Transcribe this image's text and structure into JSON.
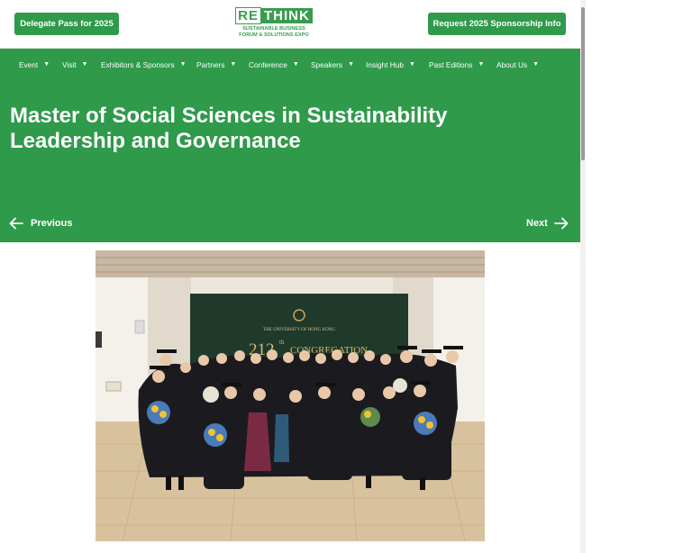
{
  "header": {
    "left_button": "Delegate Pass for 2025",
    "right_button": "Request 2025 Sponsorship Info",
    "logo_word_1": "RE",
    "logo_word_2": "THINK",
    "logo_line_1": "SUSTAINABLE BUSINESS",
    "logo_line_2": "FORUM & SOLUTIONS EXPO"
  },
  "nav": {
    "items": [
      {
        "label": "Event"
      },
      {
        "label": "Visit"
      },
      {
        "label": "Exhibitors & Sponsors"
      },
      {
        "label": "Partners"
      },
      {
        "label": "Conference"
      },
      {
        "label": "Speakers"
      },
      {
        "label": "Insight Hub"
      },
      {
        "label": "Past Editions"
      },
      {
        "label": "About Us"
      }
    ],
    "caret": "▼"
  },
  "hero": {
    "title": "Master of Social Sciences in Sustainability Leadership and Governance",
    "prev_label": "Previous",
    "next_label": "Next"
  },
  "photo": {
    "banner_line": "THE UNIVERSITY OF HONG KONG",
    "banner_number": "212",
    "banner_suffix": "th",
    "banner_word": "CONGREGATION"
  },
  "colors": {
    "brand_green": "#2e9a4a",
    "text_white": "#ffffff"
  }
}
